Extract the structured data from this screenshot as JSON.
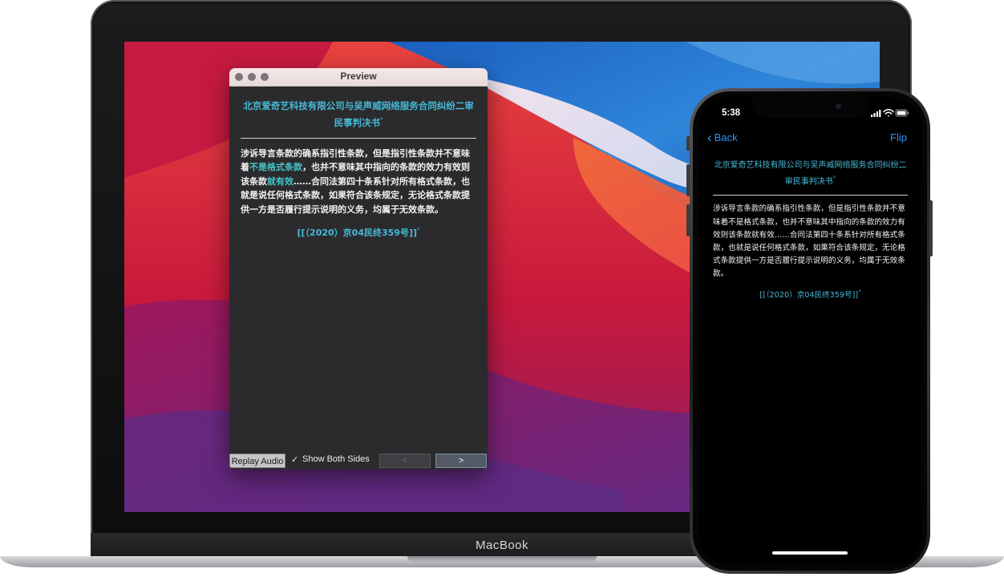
{
  "laptop": {
    "brand": "MacBook"
  },
  "preview_window": {
    "title": "Preview",
    "card": {
      "title": "北京爱奇艺科技有限公司与吴声威网络服务合同纠纷二审民事判决书",
      "title_mark": "°",
      "body_segments": [
        {
          "text": "涉诉导言条款的确系指引性条款，但是指引性条款并不意味着",
          "highlight": false
        },
        {
          "text": "不是格式条款",
          "highlight": true
        },
        {
          "text": "，也并不意味其中指向的条款的效力有效则该条款",
          "highlight": false
        },
        {
          "text": "就有效",
          "highlight": true
        },
        {
          "text": "……合同法第四十条系针对所有格式条款，也就是说任何格式条款，如果符合该条规定，无论格式条款提供一方是否履行提示说明的义务，均属于无效条款。",
          "highlight": false
        }
      ],
      "citation": "[[（2020）京04民终359号]]",
      "citation_mark": "°"
    },
    "toolbar": {
      "replay_label": "Replay Audio",
      "checkbox_mark": "✓",
      "show_both_label": "Show Both Sides",
      "prev_label": "<",
      "next_label": ">"
    }
  },
  "phone": {
    "status": {
      "time": "5:38"
    },
    "nav": {
      "back_label": "Back",
      "flip_label": "Flip"
    },
    "card": {
      "title": "北京爱奇艺科技有限公司与吴声威网络服务合同纠纷二审民事判决书",
      "title_mark": "°",
      "body": "涉诉导言条款的确系指引性条款，但是指引性条款并不意味着不是格式条款，也并不意味其中指向的条款的效力有效则该条款就有效……合同法第四十条系针对所有格式条款，也就是说任何格式条款，如果符合该条规定，无论格式条款提供一方是否履行提示说明的义务，均属于无效条款。",
      "citation": "[[（2020）京04民终359号]]",
      "citation_mark": "°"
    }
  },
  "colors": {
    "accent_teal": "#46b9d8",
    "ios_blue": "#2f93f3",
    "window_bg": "#2b2b2d"
  }
}
